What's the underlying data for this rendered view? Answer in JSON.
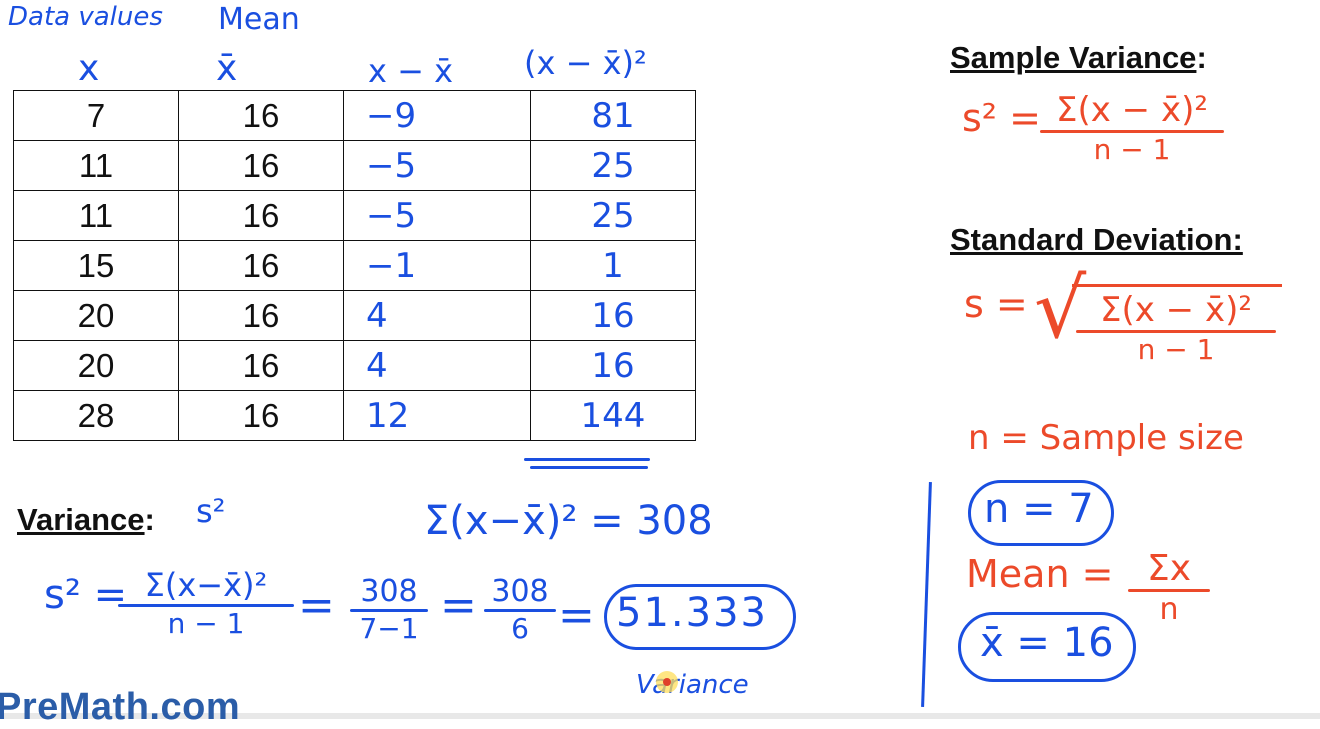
{
  "headers": {
    "data_values": "Data values",
    "mean": "Mean",
    "x": "x",
    "xbar": "x̄",
    "deviation": "x − x̄",
    "squared": "(x − x̄)²"
  },
  "table": {
    "rows": [
      {
        "x": "7",
        "mean": "16",
        "dev": "−9",
        "sq": "81"
      },
      {
        "x": "11",
        "mean": "16",
        "dev": "−5",
        "sq": "25"
      },
      {
        "x": "11",
        "mean": "16",
        "dev": "−5",
        "sq": "25"
      },
      {
        "x": "15",
        "mean": "16",
        "dev": "−1",
        "sq": "1"
      },
      {
        "x": "20",
        "mean": "16",
        "dev": "4",
        "sq": "16"
      },
      {
        "x": "20",
        "mean": "16",
        "dev": "4",
        "sq": "16"
      },
      {
        "x": "28",
        "mean": "16",
        "dev": "12",
        "sq": "144"
      }
    ]
  },
  "variance_section": {
    "label": "Variance",
    "colon": ":",
    "symbol": "s²",
    "sum_eq": "Σ(x−x̄)² = 308",
    "lhs": "s² =",
    "f1_num": "Σ(x−x̄)²",
    "f1_den": "n − 1",
    "eq": "=",
    "f2_num": "308",
    "f2_den": "7−1",
    "f3_num": "308",
    "f3_den": "6",
    "result": "51.333",
    "result_note": "Variance"
  },
  "right_panel": {
    "sample_variance_heading": "Sample Variance",
    "sv_lhs": "s² =",
    "sv_num": "Σ(x − x̄)²",
    "sv_den": "n − 1",
    "std_dev_heading": "Standard Deviation",
    "sd_lhs": "s =",
    "sd_radical": "√",
    "sd_num": "Σ(x − x̄)²",
    "sd_den": "n − 1",
    "n_def": "n = Sample size",
    "n_value": "n = 7",
    "mean_lhs": "Mean =",
    "mean_num": "Σx",
    "mean_den": "n",
    "mean_value": "x̄ = 16"
  },
  "watermark": "PreMath.com",
  "colors": {
    "blue": "#1a4fe0",
    "red": "#ec4a2a",
    "black": "#111111"
  }
}
